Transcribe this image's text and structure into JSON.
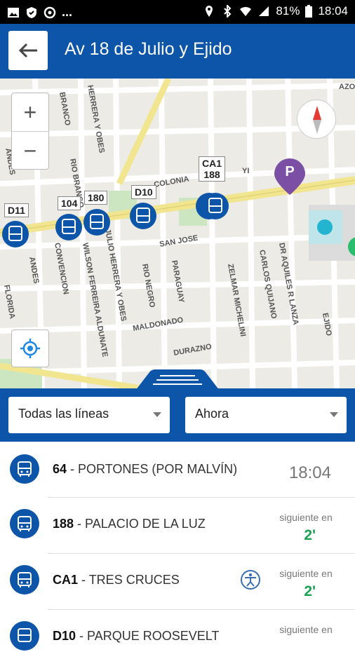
{
  "status_bar": {
    "battery": "81%",
    "time": "18:04",
    "dots": "..."
  },
  "header": {
    "title": "Av 18 de Julio y Ejido",
    "back_icon": "arrow-left-icon"
  },
  "map": {
    "zoom_in": "+",
    "zoom_out": "−",
    "bus_labels": [
      {
        "text": "D11"
      },
      {
        "text": "104"
      },
      {
        "text": "180"
      },
      {
        "text": "D10"
      },
      {
        "text": "CA1\n188"
      }
    ],
    "parking_label": "P",
    "streets": [
      "ANDES",
      "BRANCO",
      "HERRERA Y OBES",
      "RIO BRANCO",
      "COLONIA",
      "YI",
      "SAN JOSE",
      "CONVENCION",
      "WILSON FERREIRA ALDUNATE",
      "JULIO HERRERA Y OBES",
      "RIO NEGRO",
      "PARAGUAY",
      "MALDONADO",
      "DURAZNO",
      "ZELMAR MICHELINI",
      "CARLOS QUIJANO",
      "DR AQUILES R LANZA",
      "EJIDO",
      "FLORIDA",
      "ANDES",
      "AZOS"
    ]
  },
  "filters": {
    "lines": "Todas las líneas",
    "time": "Ahora"
  },
  "arrivals": [
    {
      "line": "64",
      "dest": "PORTONES (POR MALVÍN)",
      "time": "18:04"
    },
    {
      "line": "188",
      "dest": "PALACIO DE LA LUZ",
      "next_label": "siguiente en",
      "eta": "2'"
    },
    {
      "line": "CA1",
      "dest": "TRES CRUCES",
      "next_label": "siguiente en",
      "eta": "2'",
      "accessible": true
    },
    {
      "line": "D10",
      "dest": "PARQUE ROOSEVELT",
      "next_label": "siguiente en"
    }
  ],
  "colors": {
    "primary": "#0d55a8",
    "eta_green": "#1aa253",
    "parking": "#7b4fa3"
  }
}
